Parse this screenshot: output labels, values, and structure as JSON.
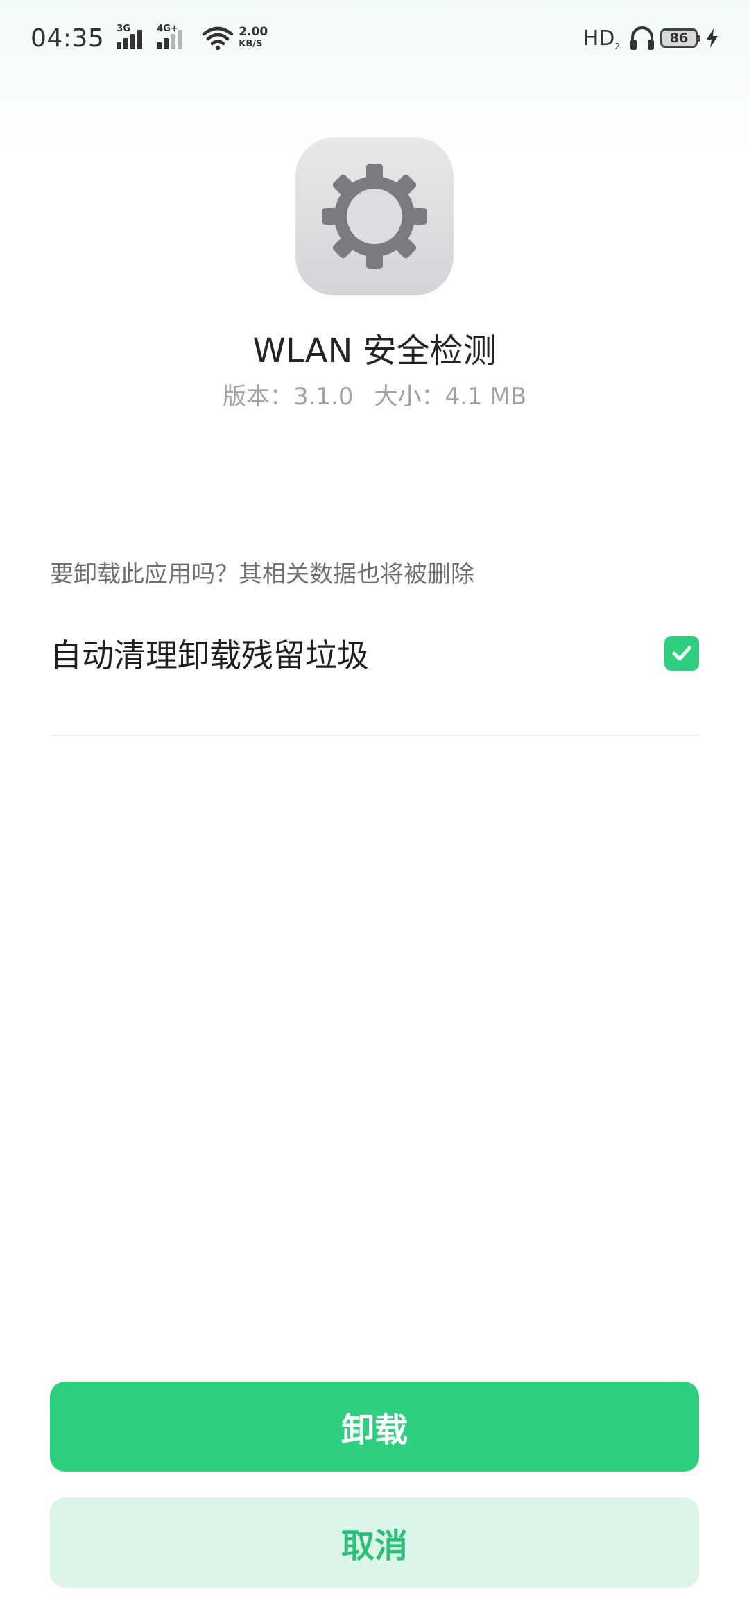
{
  "status_bar": {
    "time": "04:35",
    "sim1_type": "3G",
    "sim2_type": "4G+",
    "net_speed_value": "2.00",
    "net_speed_unit": "KB/S",
    "hd_label": "HD",
    "hd_sub": "2",
    "battery_level": "86",
    "icons": [
      "signal-icon",
      "wifi-icon",
      "headset-icon",
      "battery-icon",
      "charging-bolt-icon"
    ]
  },
  "app": {
    "icon": "gear-icon",
    "name": "WLAN 安全检测",
    "version": "版本：3.1.0",
    "size": "大小：4.1 MB"
  },
  "dialog": {
    "question": "要卸载此应用吗？其相关数据也将被删除",
    "option_label": "自动清理卸载残留垃圾",
    "option_checked": true
  },
  "buttons": {
    "uninstall": "卸载",
    "cancel": "取消"
  },
  "colors": {
    "accent": "#2dd07f",
    "cancel_bg": "#dcf5e9",
    "cancel_text": "#2dbf7a",
    "meta_text": "#a3a3a3"
  }
}
